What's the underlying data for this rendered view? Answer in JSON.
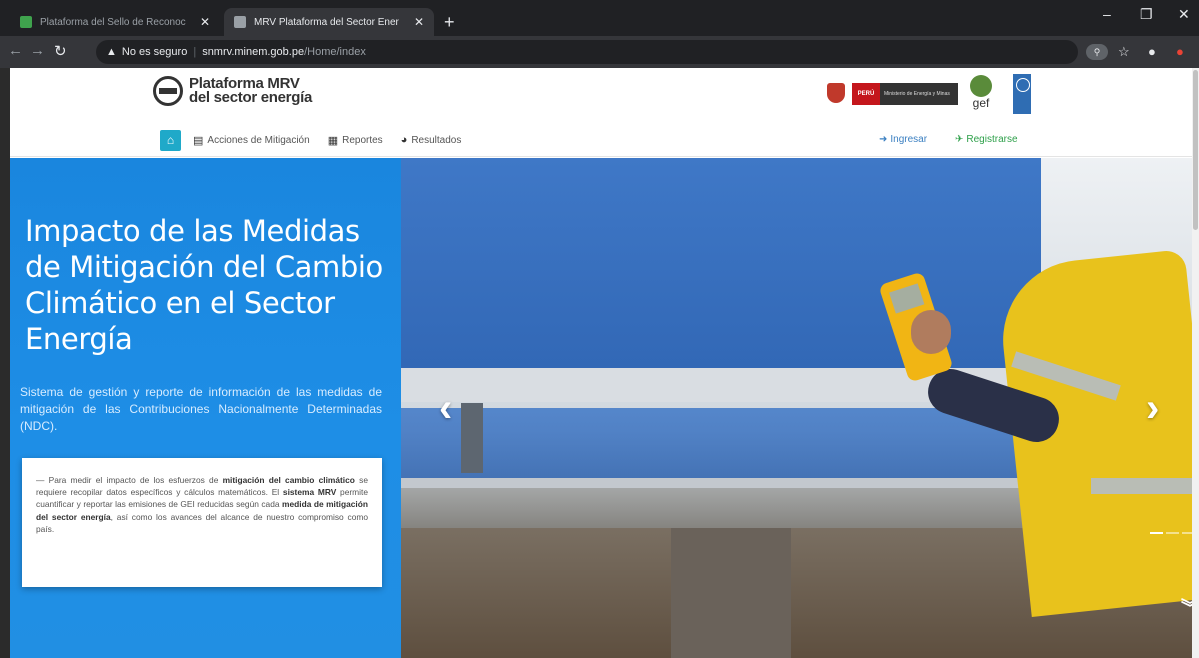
{
  "browser": {
    "tabs": [
      {
        "title": "Plataforma del Sello de Reconoc",
        "active": false
      },
      {
        "title": "MRV Plataforma del Sector Ener",
        "active": true
      }
    ],
    "security_label": "No es seguro",
    "url_host": "snmrv.minem.gob.pe",
    "url_path": "/Home/index",
    "ext_badge": "⚲"
  },
  "site": {
    "logo": {
      "line1": "Plataforma MRV",
      "line2": "del sector energía"
    },
    "partners": {
      "peru": "PERÚ",
      "ministry": "Ministerio de Energía y Minas",
      "gef": "gef"
    },
    "nav": {
      "home_icon": "⌂",
      "items": [
        {
          "icon": "▤",
          "label": "Acciones de Mitigación"
        },
        {
          "icon": "▦",
          "label": "Reportes"
        },
        {
          "icon": "◕",
          "label": "Resultados"
        }
      ],
      "login": "Ingresar",
      "register": "Registrarse"
    },
    "hero": {
      "title": "Impacto de las Medidas de Mitigación del Cambio Climático en el Sector Energía",
      "subtitle": "Sistema de gestión y reporte de información de las medidas de mitigación de las Contribuciones Nacionalmente Determinadas (NDC).",
      "card": {
        "p1": "— Para medir el impacto de los esfuerzos de ",
        "b1": "mitigación del cambio climático",
        "p2": " se requiere recopilar datos específicos y cálculos matemáticos. El ",
        "b2": "sistema MRV",
        "p3": " permite cuantificar y reportar las emisiones de GEI reducidas según cada ",
        "b3": "medida de mitigación del sector energía",
        "p4": ", así como los avances del alcance de nuestro compromiso como país."
      },
      "prev": "‹",
      "next": "›",
      "scroll": "︾",
      "slides": 6,
      "active_slide": 1
    }
  }
}
